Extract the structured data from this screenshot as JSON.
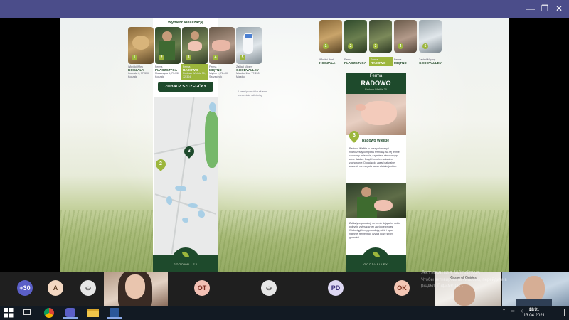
{
  "window": {
    "minimize": "—",
    "restore": "❐",
    "close": "✕"
  },
  "locations": {
    "title": "Wybierz lokalizację",
    "items": [
      {
        "num": "1",
        "type": "Wkrótki Wiek",
        "name": "KOCZAŁA",
        "addr": "Koczała 4, 77-330 Koczała",
        "selected": false
      },
      {
        "num": "2",
        "type": "Ferma",
        "name": "PLASZCZYCA",
        "addr": "Płaszczyca 6, 77-330 Koczała",
        "selected": false
      },
      {
        "num": "3",
        "type": "Ferma",
        "name": "RADOWO",
        "addr": "Radowo Wielkie 30, 72-304",
        "selected": true
      },
      {
        "num": "4",
        "type": "Ferma",
        "name": "MIĘTNO",
        "addr": "Miętno 1, 78-400 Szczecinek",
        "selected": false
      },
      {
        "num": "5",
        "type": "Zakład Mięsny",
        "name": "GOODVALLEY",
        "addr": "Miastko 10a, 77-200 Miastko",
        "selected": false
      }
    ],
    "button": "ZOBACZ SZCZEGÓŁY",
    "side_note": "Lorem ipsum dolor sit amet consectetur adipiscing",
    "map_pins": [
      "2",
      "3"
    ],
    "footer": "GOODVALLEY"
  },
  "farm": {
    "label": "Ferma",
    "name": "RADOWO",
    "sub": "Radowo Wielkie 30",
    "pin": "3",
    "place": "Radowo Wielkie",
    "text1": "Radowo Wielkie to nasz pokazowy i nowoczesny kompleks fermowy. Na tej fermie chowamy zwierzęta, czynnie w nim stosując wiele działań. Dzięki temu ich naturalne zachowanie. Dodając do zasad naturalne warunki, nie ma pola sama właśnie jest ich.",
    "text2": "Zakłady w produkcji na fermie dają w tej sobie, pokrycie zwierzę w ten zwróćcie proces. Wodociągi fermy produkują wiele i spod najmniej fermentacji używa go ze strony godności.",
    "footer": "GOODVALLEY"
  },
  "call": {
    "participants": [
      {
        "initials": "+30",
        "color": "#5b5fc7",
        "text_color": "#ffffff"
      },
      {
        "initials": "A",
        "color": "#f4d8c2",
        "text_color": "#5a3a22"
      },
      {
        "initials": "OT",
        "color": "#f2c0b4",
        "text_color": "#7a2a1e"
      },
      {
        "initials": "PD",
        "color": "#ddd7f2",
        "text_color": "#3b2f7a"
      },
      {
        "initials": "OK",
        "color": "#f3c6b4",
        "text_color": "#7a2e1a"
      }
    ],
    "activation_title": "Активация Windows",
    "activation_text": "Чтобы активировать Windows, перейдите в раздел \"Параметры\".",
    "video_label": "Klasse of Guides"
  },
  "taskbar": {
    "lang": "РУС",
    "time": "11:31",
    "date": "13.04.2021"
  },
  "colors": {
    "brand_dark": "#1e4a2c",
    "brand_green": "#9cb63c",
    "titlebar": "#4b4d8a"
  }
}
